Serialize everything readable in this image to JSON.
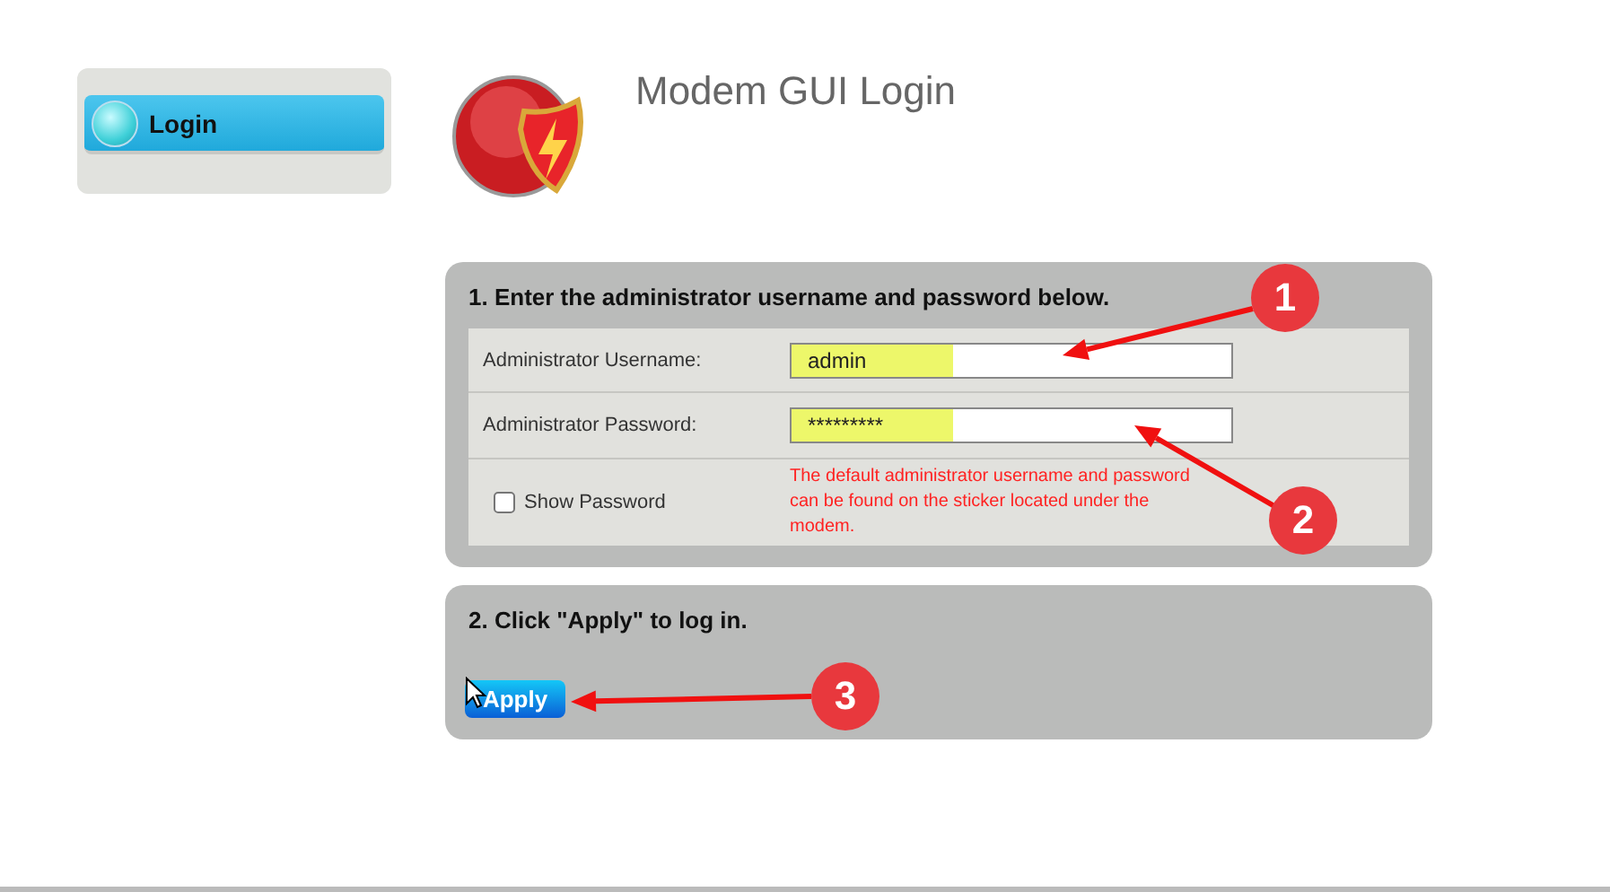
{
  "sidebar": {
    "items": [
      {
        "label": "Login",
        "selected": true
      }
    ]
  },
  "title": "Modem GUI Login",
  "step1": {
    "heading": "1. Enter the administrator username and password below.",
    "fields": [
      {
        "label": "Administrator Username:",
        "value": "admin"
      },
      {
        "label": "Administrator Password:",
        "value": "*********"
      }
    ],
    "show_password": {
      "label": "Show Password",
      "checked": false
    },
    "note": "The default administrator username and password can be found on the sticker located under the modem."
  },
  "step2": {
    "heading": "2. Click \"Apply\" to log in.",
    "button": "Apply"
  },
  "annotations": [
    "1",
    "2",
    "3"
  ]
}
